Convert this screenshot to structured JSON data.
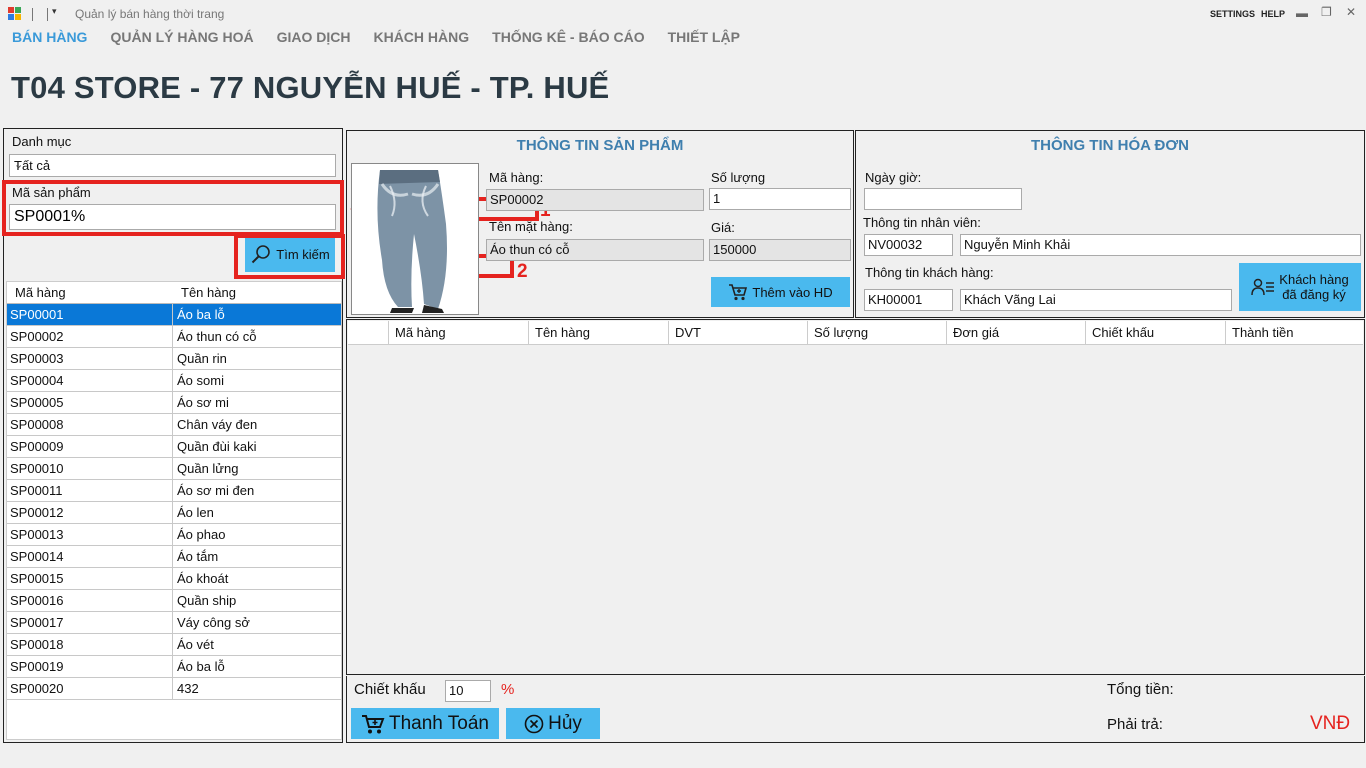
{
  "window": {
    "title": "Quản lý bán hàng thời trang",
    "settings": "SETTINGS",
    "help": "HELP",
    "minimize": "▬",
    "restore": "❐",
    "close": "✕"
  },
  "menu": {
    "items": [
      "BÁN HÀNG",
      "QUẢN LÝ HÀNG HOÁ",
      "GIAO DỊCH",
      "KHÁCH HÀNG",
      "THỐNG KÊ - BÁO CÁO",
      "THIẾT LẬP"
    ],
    "active_index": 0
  },
  "store_title": "T04 STORE - 77 NGUYỄN HUẾ - TP. HUẾ",
  "left": {
    "category_label": "Danh mục",
    "category_value": "Tất cả",
    "product_code_label": "Mã sản phẩm",
    "product_code_value": "SP0001%",
    "search_button": "Tìm kiếm",
    "columns": [
      "Mã hàng",
      "Tên hàng"
    ],
    "rows": [
      [
        "SP00001",
        "Áo ba lỗ"
      ],
      [
        "SP00002",
        "Áo thun có cỗ"
      ],
      [
        "SP00003",
        "Quần rin"
      ],
      [
        "SP00004",
        "Áo somi"
      ],
      [
        "SP00005",
        "Áo sơ mi"
      ],
      [
        "SP00008",
        "Chân váy đen"
      ],
      [
        "SP00009",
        "Quần đùi kaki"
      ],
      [
        "SP00010",
        "Quần lửng"
      ],
      [
        "SP00011",
        "Áo sơ mi đen"
      ],
      [
        "SP00012",
        "Áo len"
      ],
      [
        "SP00013",
        "Áo phao"
      ],
      [
        "SP00014",
        "Áo tắm"
      ],
      [
        "SP00015",
        "Áo khoát"
      ],
      [
        "SP00016",
        "Quần ship"
      ],
      [
        "SP00017",
        "Váy công sở"
      ],
      [
        "SP00018",
        "Áo vét"
      ],
      [
        "SP00019",
        "Áo ba lỗ"
      ],
      [
        "SP00020",
        "432"
      ]
    ],
    "selected_row": 0
  },
  "annotations": {
    "label1": "1",
    "label2": "2",
    "color": "#e5231f"
  },
  "product": {
    "title": "THÔNG TIN SẢN PHẨM",
    "code_label": "Mã hàng:",
    "code_value": "SP00002",
    "name_label": "Tên mặt hàng:",
    "name_value": "Áo thun có cỗ",
    "qty_label": "Số lượng",
    "qty_value": "1",
    "price_label": "Giá:",
    "price_value": "150000",
    "add_button": "Thêm vào HD",
    "image_icon": "jeans-product-image"
  },
  "invoice": {
    "title": "THÔNG TIN HÓA ĐƠN",
    "datetime_label": "Ngày giờ:",
    "datetime_value": "",
    "staff_label": "Thông tin nhân viên:",
    "staff_id": "NV00032",
    "staff_name": "Nguyễn Minh Khải",
    "customer_label": "Thông tin khách hàng:",
    "customer_id": "KH00001",
    "customer_name": "Khách Vãng Lai",
    "registered_button_line1": "Khách hàng",
    "registered_button_line2": "đã đăng ký"
  },
  "items": {
    "columns": [
      "Mã hàng",
      "Tên hàng",
      "DVT",
      "Số lượng",
      "Đơn giá",
      "Chiết khấu",
      "Thành tiền"
    ]
  },
  "footer": {
    "discount_label": "Chiết khấu",
    "discount_value": "10",
    "percent": "%",
    "total_label": "Tổng tiền:",
    "payable_label": "Phải trả:",
    "currency": "VNĐ",
    "pay_button": "Thanh Toán",
    "cancel_button": "Hủy"
  },
  "colors": {
    "accent": "#4ab9ee",
    "menu_active": "#3a9ad9",
    "selection": "#0a78d7",
    "panel_title": "#3f7fae",
    "red": "#e5231f"
  }
}
